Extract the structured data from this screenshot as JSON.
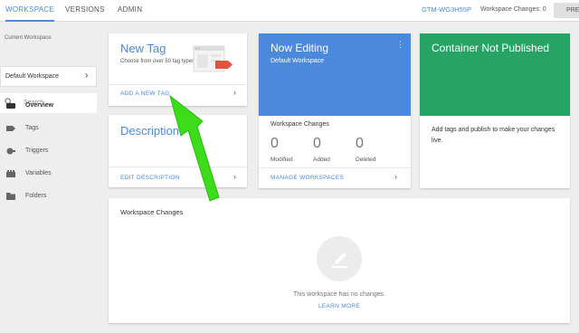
{
  "topbar": {
    "tabs": [
      {
        "label": "WORKSPACE",
        "active": true
      },
      {
        "label": "VERSIONS",
        "active": false
      },
      {
        "label": "ADMIN",
        "active": false
      }
    ],
    "container_id": "GTM-WG3H55P",
    "workspace_changes": "Workspace Changes: 0",
    "preview_label": "PREV"
  },
  "sidebar": {
    "current_workspace_label": "Current Workspace",
    "workspace_name": "Default Workspace",
    "search_placeholder": "Search",
    "nav": [
      {
        "label": "Overview",
        "icon": "overview-icon",
        "active": true
      },
      {
        "label": "Tags",
        "icon": "tag-icon",
        "active": false
      },
      {
        "label": "Triggers",
        "icon": "trigger-icon",
        "active": false
      },
      {
        "label": "Variables",
        "icon": "variable-icon",
        "active": false
      },
      {
        "label": "Folders",
        "icon": "folder-icon",
        "active": false
      }
    ]
  },
  "cards": {
    "new_tag": {
      "title": "New Tag",
      "description": "Choose from over 50 tag types.",
      "link": "ADD A NEW TAG"
    },
    "description": {
      "title": "Description",
      "link": "EDIT DESCRIPTION"
    },
    "now_editing": {
      "title": "Now Editing",
      "subtitle": "Default Workspace",
      "changes_label": "Workspace Changes",
      "counts": [
        {
          "value": "0",
          "label": "Modified"
        },
        {
          "value": "0",
          "label": "Added"
        },
        {
          "value": "0",
          "label": "Deleted"
        }
      ],
      "link": "MANAGE WORKSPACES"
    },
    "not_published": {
      "title": "Container Not Published",
      "text": "Add tags and publish to make your changes live."
    }
  },
  "changes_panel": {
    "title": "Workspace Changes",
    "empty_text": "This workspace has no changes.",
    "learn_more": "LEARN MORE"
  },
  "colors": {
    "accent": "#4a89dc",
    "published_green": "#27a464",
    "arrow_green": "#3ddc1a"
  }
}
